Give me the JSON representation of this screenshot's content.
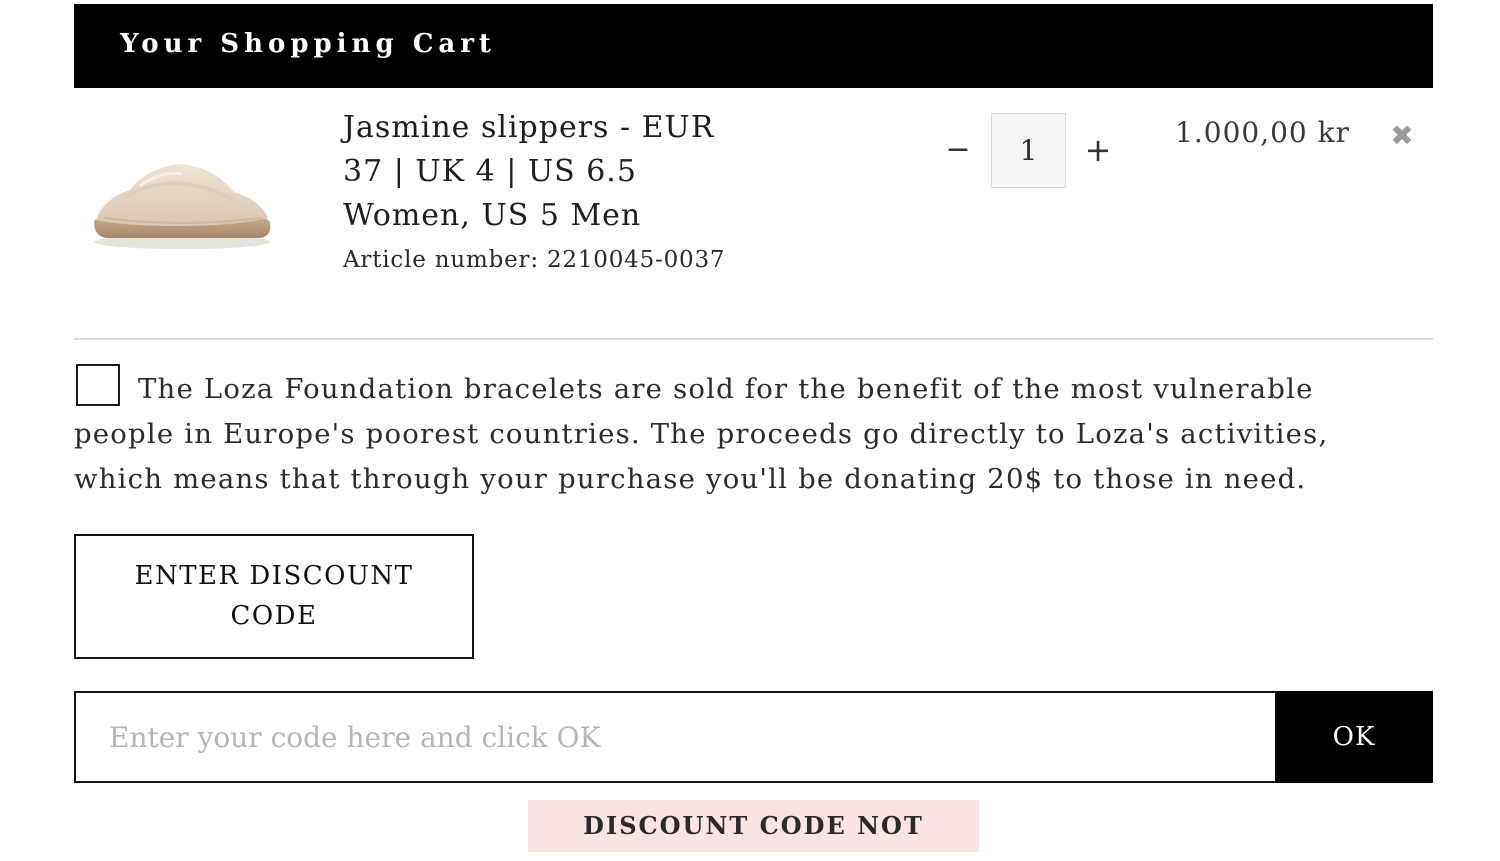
{
  "header": {
    "title": "Your Shopping Cart"
  },
  "cart_item": {
    "image_alt": "Jasmine slippers",
    "name": "Jasmine slippers - EUR 37 | UK 4 | US 6.5 Women, US 5 Men",
    "article_number": "Article number: 2210045-0037",
    "quantity": "1",
    "minus_label": "−",
    "plus_label": "+",
    "price": "1.000,00 kr",
    "remove_icon": "✖"
  },
  "donation": {
    "checked": false,
    "text": "The Loza Foundation bracelets are sold for the benefit of the most vulnerable people in Europe's poorest countries. The proceeds go directly to Loza's activities, which means that through your purchase you'll be donating 20$ to those in need."
  },
  "discount": {
    "toggle_label": "ENTER DISCOUNT CODE",
    "input_value": "",
    "input_placeholder": "Enter your code here and click OK",
    "ok_label": "OK",
    "error_message": "DISCOUNT CODE NOT FOUND."
  },
  "colors": {
    "header_bg": "#000000",
    "error_bg": "#fbe4e4",
    "divider": "#dedad3"
  }
}
